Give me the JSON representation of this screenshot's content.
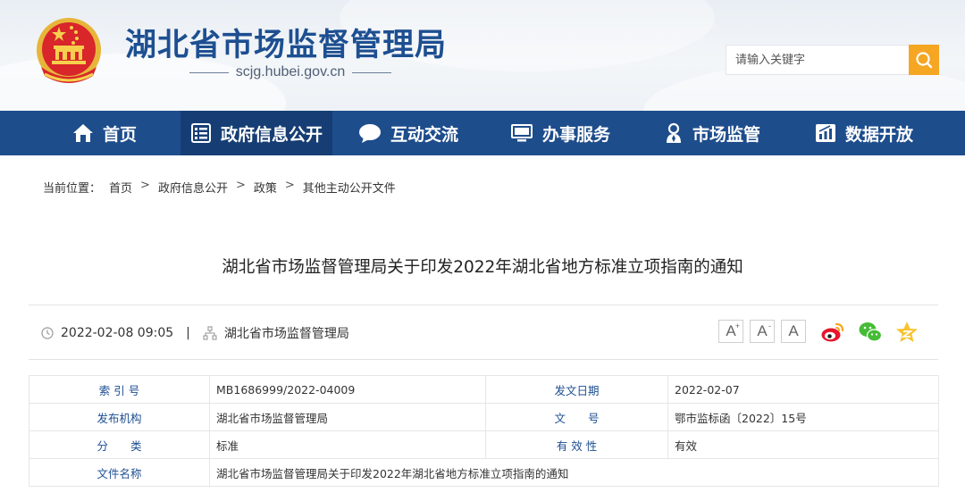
{
  "header": {
    "site_title": "湖北省市场监督管理局",
    "site_url": "scjg.hubei.gov.cn",
    "search_placeholder": "请输入关键字",
    "emblem_icon": "national-emblem-icon"
  },
  "nav": {
    "items": [
      {
        "label": "首页",
        "icon": "home-icon"
      },
      {
        "label": "政府信息公开",
        "icon": "document-list-icon"
      },
      {
        "label": "互动交流",
        "icon": "chat-bubble-icon"
      },
      {
        "label": "办事服务",
        "icon": "monitor-icon"
      },
      {
        "label": "市场监管",
        "icon": "inspector-icon"
      },
      {
        "label": "数据开放",
        "icon": "chart-icon"
      }
    ]
  },
  "breadcrumb": {
    "prefix": "当前位置：",
    "items": [
      "首页",
      "政府信息公开",
      "政策",
      "其他主动公开文件"
    ],
    "separator": ">"
  },
  "article": {
    "title": "湖北省市场监督管理局关于印发2022年湖北省地方标准立项指南的通知",
    "datetime": "2022-02-08 09:05",
    "divider": "|",
    "source": "湖北省市场监督管理局",
    "font_sizes": [
      "A",
      "A",
      "A"
    ],
    "font_increase_mark": "+",
    "font_decrease_mark": "-"
  },
  "info": {
    "rows": [
      {
        "label1": "索 引 号",
        "value1": "MB1686999/2022-04009",
        "label2": "发文日期",
        "value2": "2022-02-07"
      },
      {
        "label1": "发布机构",
        "value1": "湖北省市场监督管理局",
        "label2": "文　　号",
        "value2": "鄂市监标函〔2022〕15号"
      },
      {
        "label1": "分　　类",
        "value1": "标准",
        "label2": "有 效 性",
        "value2": "有效"
      },
      {
        "label1": "文件名称",
        "value1": "湖北省市场监督管理局关于印发2022年湖北省地方标准立项指南的通知"
      }
    ]
  },
  "colors": {
    "nav_bg": "#1e4d8c",
    "nav_active": "#163e74",
    "title_blue": "#1d4f91",
    "search_button": "#f5a623"
  }
}
